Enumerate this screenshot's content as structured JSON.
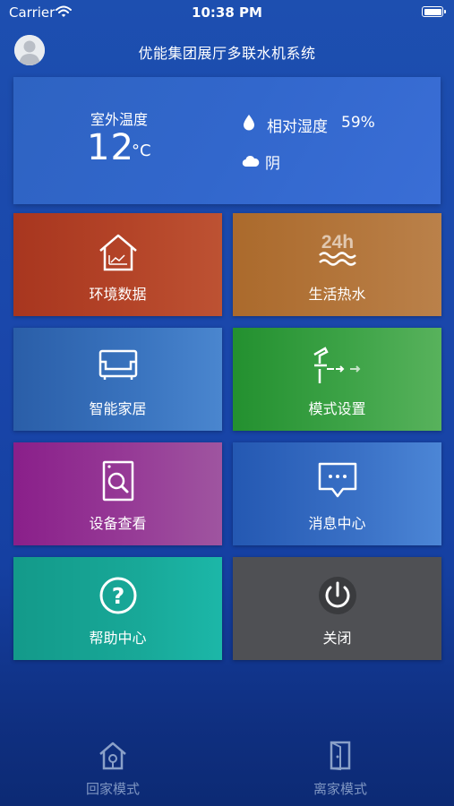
{
  "status_bar": {
    "carrier": "Carrier",
    "time": "10:38 PM"
  },
  "header": {
    "title": "优能集团展厅多联水机系统",
    "avatar_icon": "user-avatar-icon"
  },
  "weather": {
    "outdoor_label": "室外温度",
    "temperature": "12",
    "unit": "°C",
    "humidity_label": "相对湿度",
    "humidity_value": "59%",
    "condition": "阴",
    "humidity_icon": "water-drop-icon",
    "condition_icon": "cloud-icon"
  },
  "tiles": [
    {
      "label": "环境数据",
      "icon": "house-chart-icon",
      "color": "#b44428"
    },
    {
      "label": "生活热水",
      "icon": "hot-water-24h-icon",
      "color": "#b4773d"
    },
    {
      "label": "智能家居",
      "icon": "sofa-icon",
      "color": "#3a74bf"
    },
    {
      "label": "模式设置",
      "icon": "mode-faucet-icon",
      "color": "#3da347"
    },
    {
      "label": "设备查看",
      "icon": "device-search-icon",
      "color": "#963a96"
    },
    {
      "label": "消息中心",
      "icon": "message-bubble-icon",
      "color": "#3a71c6"
    },
    {
      "label": "帮助中心",
      "icon": "help-icon",
      "color": "#18a898"
    },
    {
      "label": "关闭",
      "icon": "power-icon",
      "color": "#4f5054"
    }
  ],
  "bottom_nav": [
    {
      "label": "回家模式",
      "icon": "home-mode-icon"
    },
    {
      "label": "离家模式",
      "icon": "door-exit-icon"
    }
  ]
}
